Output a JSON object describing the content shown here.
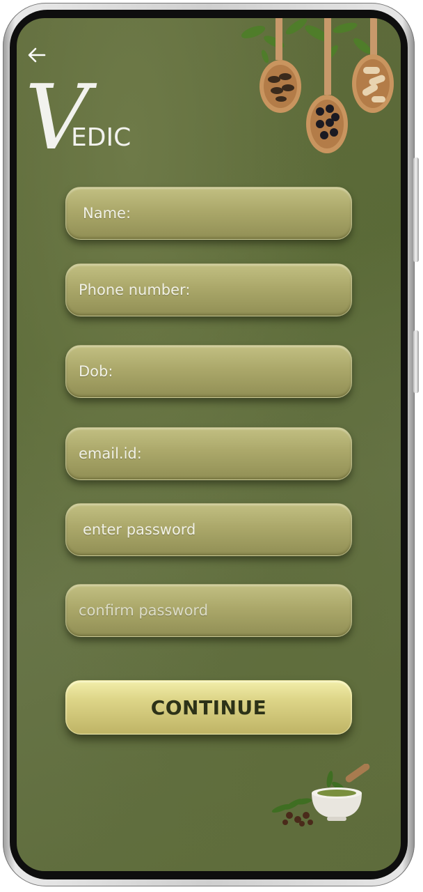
{
  "app": {
    "logo_initial": "V",
    "logo_rest": "EDIC"
  },
  "form": {
    "name_placeholder": "Name:",
    "phone_placeholder": "Phone number:",
    "dob_placeholder": "Dob:",
    "email_placeholder": "email.id:",
    "password_placeholder": "enter password",
    "confirm_password_placeholder": "confirm password"
  },
  "actions": {
    "continue_label": "CONTINUE"
  },
  "icons": {
    "back": "back-arrow-icon"
  },
  "colors": {
    "background": "#5f6b3c",
    "field": "#aba86a",
    "button": "#ddd588",
    "button_text": "#2d3218"
  }
}
